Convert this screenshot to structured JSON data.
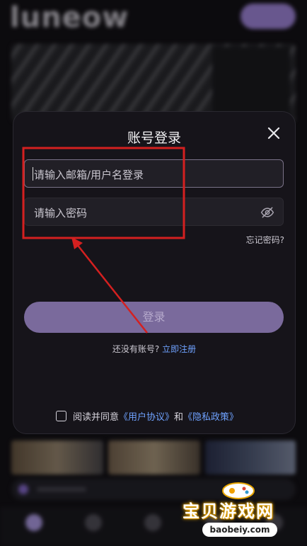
{
  "background": {
    "logo_text": "luneow"
  },
  "modal": {
    "title": "账号登录",
    "username_placeholder": "请输入邮箱/用户名登录",
    "password_placeholder": "请输入密码",
    "forgot_password": "忘记密码?",
    "login_button": "登录",
    "no_account_text": "还没有账号?",
    "register_link": "立即注册",
    "agreement": {
      "prefix": "阅读并同意",
      "user_agreement": "《用户协议》",
      "and": "和",
      "privacy_policy": "《隐私政策》"
    }
  },
  "watermark": {
    "text": "宝贝游戏网",
    "url": "baobeiy.com"
  },
  "colors": {
    "accent": "#7a6a9c",
    "link": "#6fa2ff",
    "annotation": "#d42020"
  },
  "icons": [
    "close-icon",
    "eye-hidden-icon",
    "checkbox-icon",
    "gamepad-icon"
  ]
}
